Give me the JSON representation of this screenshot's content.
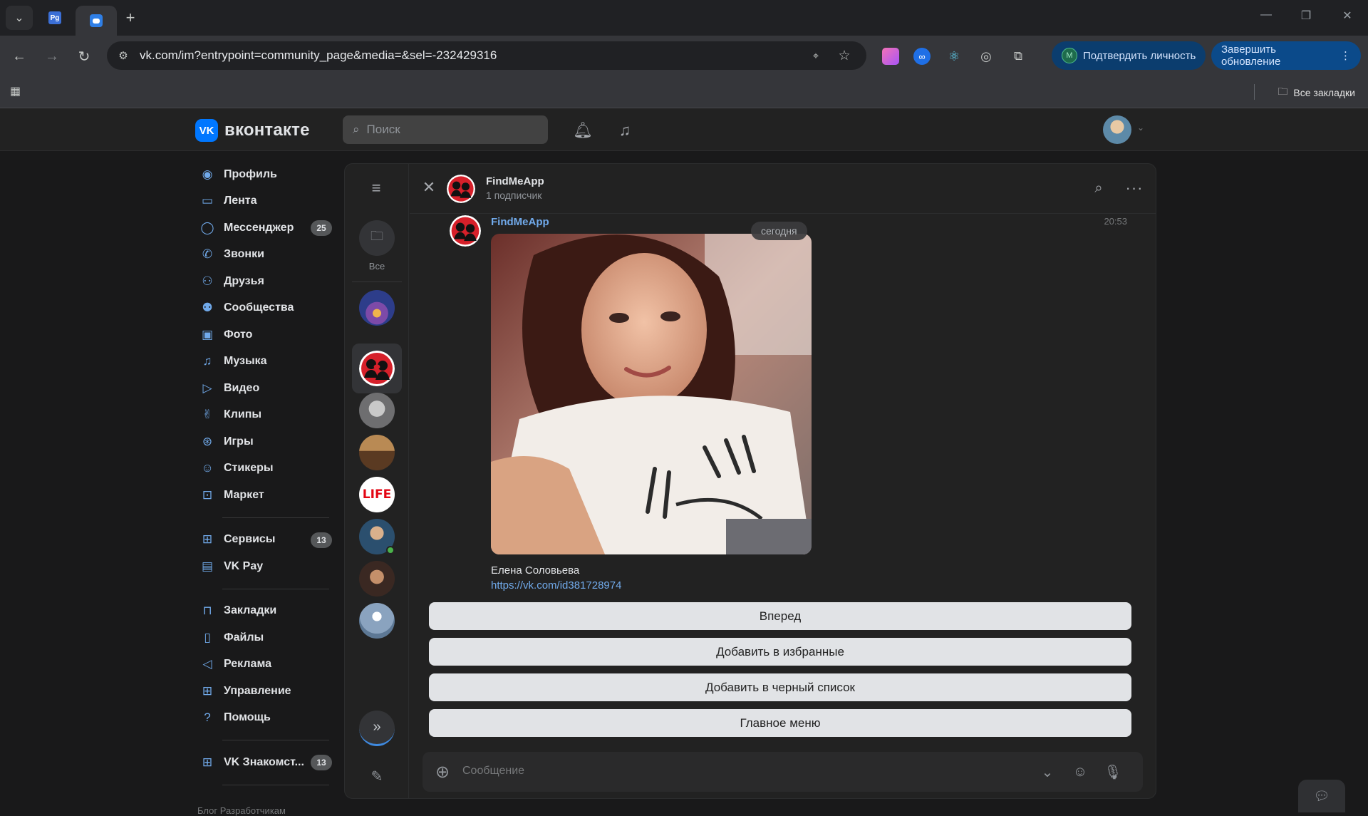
{
  "browser": {
    "url": "vk.com/im?entrypoint=community_page&media=&sel=-232429316",
    "tab_pg_favicon": "Pg",
    "verify_pill": "Подтвердить личность",
    "verify_pill_avatar": "M",
    "update_pill": "Завершить обновление",
    "all_bookmarks": "Все закладки"
  },
  "vk_header": {
    "logo_text": "вконтакте",
    "logo_mark": "VK",
    "search_placeholder": "Поиск"
  },
  "leftnav": {
    "group1": [
      {
        "label": "Профиль",
        "icon": "profile-icon"
      },
      {
        "label": "Лента",
        "icon": "feed-icon"
      },
      {
        "label": "Мессенджер",
        "icon": "messenger-icon",
        "badge": "25"
      },
      {
        "label": "Звонки",
        "icon": "phone-icon"
      },
      {
        "label": "Друзья",
        "icon": "friends-icon"
      },
      {
        "label": "Сообщества",
        "icon": "communities-icon"
      },
      {
        "label": "Фото",
        "icon": "photo-icon"
      },
      {
        "label": "Музыка",
        "icon": "music-icon"
      },
      {
        "label": "Видео",
        "icon": "video-icon"
      },
      {
        "label": "Клипы",
        "icon": "clips-icon"
      },
      {
        "label": "Игры",
        "icon": "games-icon"
      },
      {
        "label": "Стикеры",
        "icon": "stickers-icon"
      },
      {
        "label": "Маркет",
        "icon": "market-icon"
      }
    ],
    "group2": [
      {
        "label": "Сервисы",
        "icon": "services-icon",
        "badge": "13"
      },
      {
        "label": "VK Pay",
        "icon": "vkpay-icon"
      }
    ],
    "group3": [
      {
        "label": "Закладки",
        "icon": "bookmarks-icon"
      },
      {
        "label": "Файлы",
        "icon": "files-icon"
      },
      {
        "label": "Реклама",
        "icon": "ads-icon"
      },
      {
        "label": "Управление",
        "icon": "manage-icon"
      },
      {
        "label": "Помощь",
        "icon": "help-icon"
      }
    ],
    "group4": [
      {
        "label": "VK Знакомст...",
        "icon": "app-icon",
        "badge": "13"
      }
    ],
    "footer": "Блог   Разработчикам"
  },
  "conversations": {
    "folder_label": "Все"
  },
  "chat": {
    "title": "FindMeApp",
    "subtitle": "1 подписчик",
    "message": {
      "author": "FindMeApp",
      "time": "20:53",
      "date_pill": "сегодня",
      "caption_name": "Елена Соловьева",
      "caption_link": "https://vk.com/id381728974"
    },
    "keyboard": [
      "Вперед",
      "Добавить в избранные",
      "Добавить в черный список",
      "Главное меню"
    ],
    "composer_placeholder": "Сообщение"
  },
  "colors": {
    "vk_blue": "#0077ff",
    "link_blue": "#71aaeb",
    "background": "#19191a",
    "panel": "#222222"
  }
}
